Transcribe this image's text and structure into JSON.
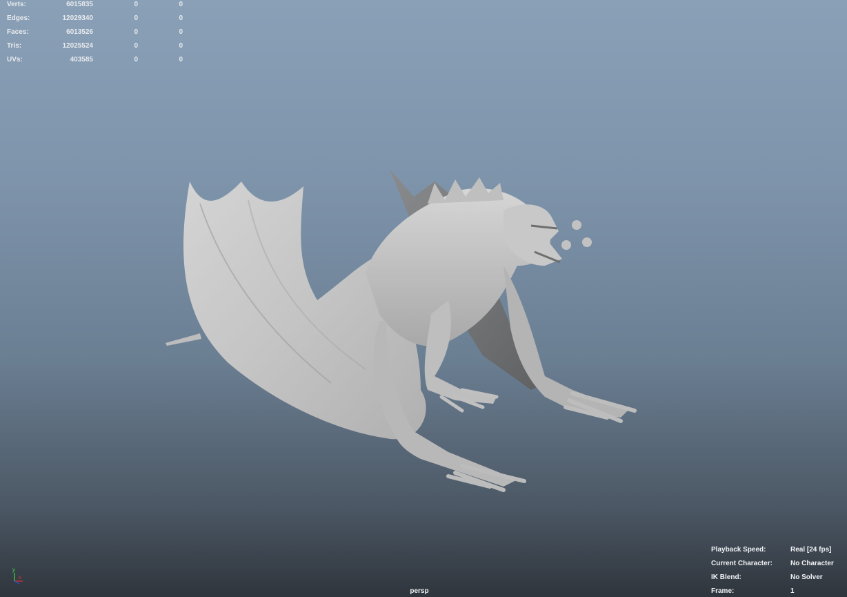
{
  "viewport": {
    "camera": "persp"
  },
  "stats": [
    {
      "label": "Verts:",
      "total": "6015835",
      "selected": "0",
      "component": "0"
    },
    {
      "label": "Edges:",
      "total": "12029340",
      "selected": "0",
      "component": "0"
    },
    {
      "label": "Faces:",
      "total": "6013526",
      "selected": "0",
      "component": "0"
    },
    {
      "label": "Tris:",
      "total": "12025524",
      "selected": "0",
      "component": "0"
    },
    {
      "label": "UVs:",
      "total": "403585",
      "selected": "0",
      "component": "0"
    }
  ],
  "info": {
    "playback_speed_label": "Playback Speed:",
    "playback_speed_value": "Real [24 fps]",
    "current_character_label": "Current Character:",
    "current_character_value": "No Character",
    "ik_blend_label": "IK Blend:",
    "ik_blend_value": "No Solver",
    "frame_label": "Frame:",
    "frame_value": "1"
  },
  "axis": {
    "y_label": "y",
    "x_label": "x",
    "y_color": "#3ddc3d",
    "x_color": "#e03030",
    "z_color": "#3050e0"
  },
  "model": {
    "icon": "dragon-sculpt-mesh",
    "color": "#c9c9c9"
  }
}
